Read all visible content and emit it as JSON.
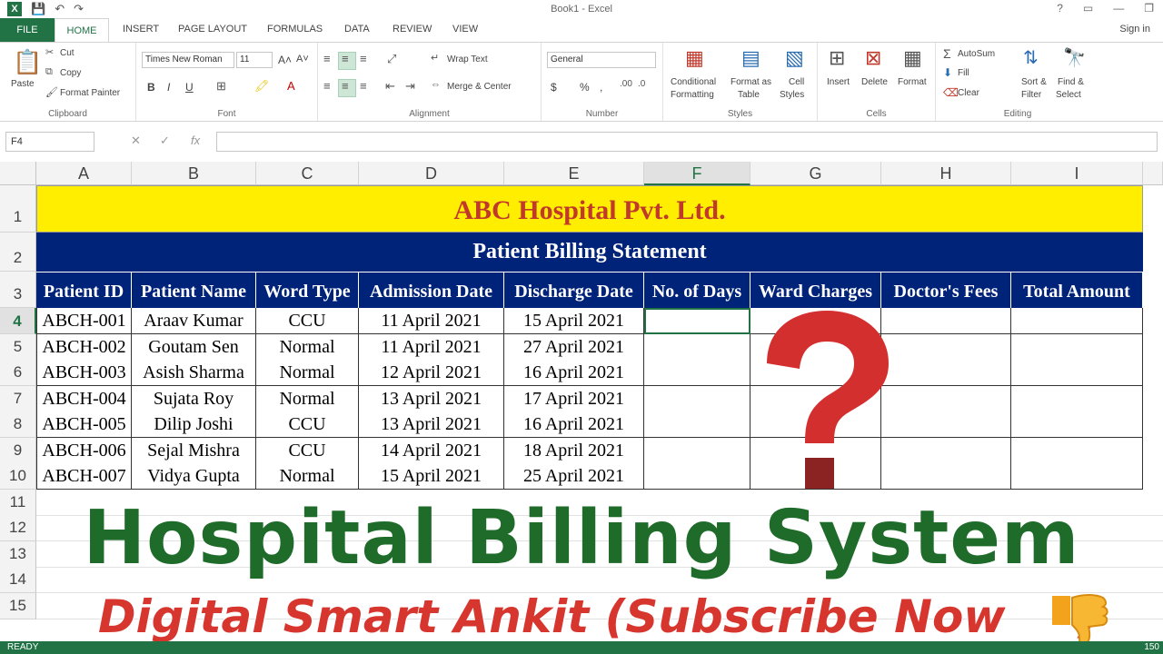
{
  "window": {
    "title": "Book1 - Excel",
    "help": "?",
    "minimize": "—",
    "restore": "❐",
    "close": "✕"
  },
  "tabs": {
    "file": "FILE",
    "home": "HOME",
    "insert": "INSERT",
    "page_layout": "PAGE LAYOUT",
    "formulas": "FORMULAS",
    "data": "DATA",
    "review": "REVIEW",
    "view": "VIEW",
    "signin": "Sign in"
  },
  "ribbon": {
    "clipboard": {
      "paste": "Paste",
      "cut": "Cut",
      "copy": "Copy",
      "format_painter": "Format Painter",
      "name": "Clipboard"
    },
    "font": {
      "font_name": "Times New Roman",
      "font_size": "11",
      "grow": "A˄",
      "shrink": "A˅",
      "bold": "B",
      "italic": "I",
      "underline": "U",
      "name": "Font"
    },
    "alignment": {
      "wrap_text": "Wrap Text",
      "merge_center": "Merge & Center",
      "name": "Alignment"
    },
    "number": {
      "format": "General",
      "currency": "$",
      "percent": "%",
      "comma": ",",
      "name": "Number"
    },
    "styles": {
      "conditional": "Conditional",
      "formatting": "Formatting",
      "format_as": "Format as",
      "table": "Table",
      "cell": "Cell",
      "styles": "Styles",
      "name": "Styles"
    },
    "cells": {
      "insert": "Insert",
      "delete": "Delete",
      "format": "Format",
      "name": "Cells"
    },
    "editing": {
      "autosum": "AutoSum",
      "fill": "Fill",
      "clear": "Clear",
      "sort": "Sort &",
      "filter": "Filter",
      "find": "Find &",
      "select": "Select",
      "name": "Editing"
    }
  },
  "formula_bar": {
    "name_box": "F4",
    "cancel": "✕",
    "enter": "✓",
    "fx": "fx",
    "value": ""
  },
  "columns": [
    "A",
    "B",
    "C",
    "D",
    "E",
    "F",
    "G",
    "H",
    "I"
  ],
  "rows": [
    "1",
    "2",
    "3",
    "4",
    "5",
    "6",
    "7",
    "8",
    "9",
    "10",
    "11",
    "12",
    "13",
    "14",
    "15"
  ],
  "sheet": {
    "title": "ABC Hospital Pvt. Ltd.",
    "subtitle": "Patient Billing Statement",
    "headers": [
      "Patient ID",
      "Patient Name",
      "Word Type",
      "Admission Date",
      "Discharge Date",
      "No. of Days",
      "Ward Charges",
      "Doctor's Fees",
      "Total Amount"
    ],
    "records": [
      [
        "ABCH-001",
        "Araav Kumar",
        "CCU",
        "11 April 2021",
        "15 April 2021",
        "",
        "",
        "",
        ""
      ],
      [
        "ABCH-002",
        "Goutam Sen",
        "Normal",
        "11 April 2021",
        "27 April 2021",
        "",
        "",
        "",
        ""
      ],
      [
        "ABCH-003",
        "Asish Sharma",
        "Normal",
        "12 April 2021",
        "16 April 2021",
        "",
        "",
        "",
        ""
      ],
      [
        "ABCH-004",
        "Sujata Roy",
        "Normal",
        "13 April 2021",
        "17 April 2021",
        "",
        "",
        "",
        ""
      ],
      [
        "ABCH-005",
        "Dilip Joshi",
        "CCU",
        "13 April 2021",
        "16 April 2021",
        "",
        "",
        "",
        ""
      ],
      [
        "ABCH-006",
        "Sejal Mishra",
        "CCU",
        "14 April 2021",
        "18 April 2021",
        "",
        "",
        "",
        ""
      ],
      [
        "ABCH-007",
        "Vidya Gupta",
        "Normal",
        "15 April 2021",
        "25 April 2021",
        "",
        "",
        "",
        ""
      ]
    ]
  },
  "overlay": {
    "headline": "Hospital Billing System",
    "subline": "Digital Smart Ankit (Subscribe Now",
    "subline_end": ")"
  },
  "status": {
    "ready": "READY",
    "zoom": "150"
  },
  "colors": {
    "excel_green": "#217346",
    "banner_yellow": "#ffee00",
    "banner_navy": "#00237a",
    "title_red": "#c0392b",
    "headline_green": "#1e6b2a",
    "subline_red": "#d7362f"
  }
}
